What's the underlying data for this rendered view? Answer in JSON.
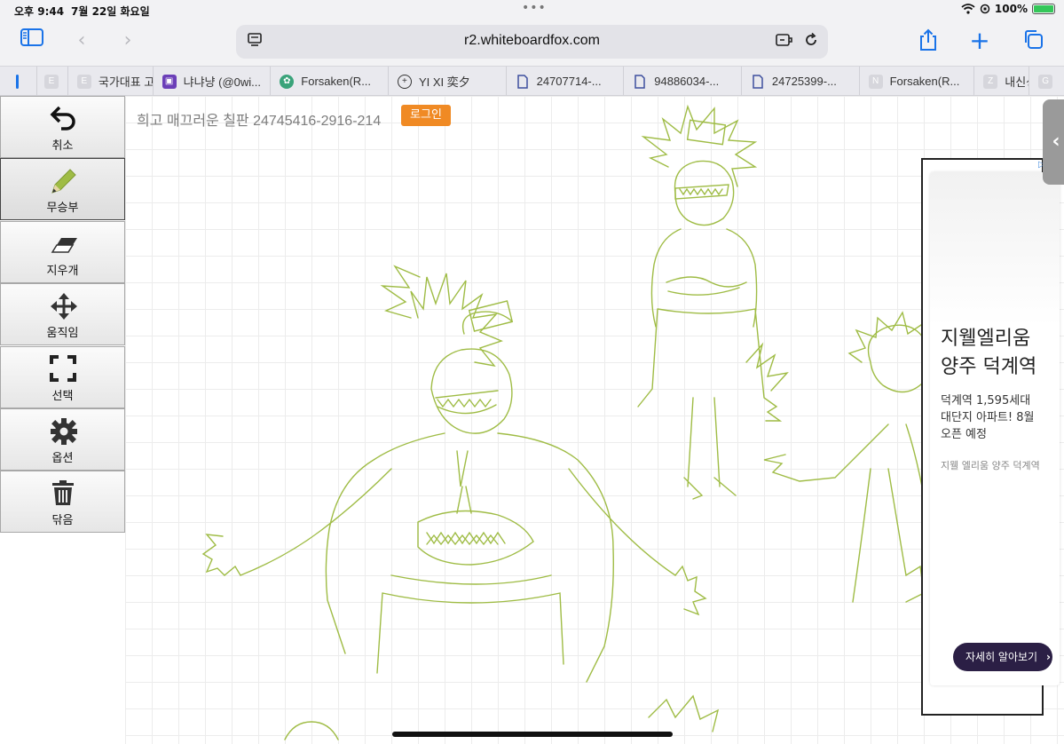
{
  "status_bar": {
    "time": "오후 9:44",
    "date": "7월 22일 화요일",
    "battery": "100%"
  },
  "browser": {
    "url": "r2.whiteboardfox.com"
  },
  "tabs": [
    {
      "favicon": "E",
      "label": ""
    },
    {
      "favicon": "E",
      "label": "국가대표 고교"
    },
    {
      "favicon": "app",
      "label": "냐냐냥 (@0wi..."
    },
    {
      "favicon": "leaf",
      "label": "Forsaken(R..."
    },
    {
      "favicon": "plus",
      "label": "YI XI 奕夕"
    },
    {
      "favicon": "doc",
      "label": "24707714-..."
    },
    {
      "favicon": "doc",
      "label": "94886034-..."
    },
    {
      "favicon": "doc",
      "label": "24725399-..."
    },
    {
      "favicon": "N",
      "label": "Forsaken(R..."
    },
    {
      "favicon": "Z",
      "label": "내신성"
    },
    {
      "favicon": "G",
      "label": ""
    }
  ],
  "tools": {
    "undo": "취소",
    "pen": "무승부",
    "eraser": "지우개",
    "move": "움직임",
    "select": "선택",
    "options": "옵션",
    "clear": "닦음"
  },
  "board": {
    "title": "희고 매끄러운 칠판 24745416-2916-214",
    "login": "로그인",
    "stroke_color": "#9fbc45"
  },
  "ad": {
    "headline_1": "지웰엘리움",
    "headline_2": "양주 덕계역",
    "body_1": "덕계역 1,595세대",
    "body_2": "대단지 아파트! 8월",
    "body_3": "오픈 예정",
    "small": "지웰 엘리움 양주 덕계역",
    "button": "자세히 알아보기"
  },
  "colors": {
    "accent": "#1a73e8",
    "login_button": "#f08a24",
    "ad_button": "#2b1f45"
  }
}
